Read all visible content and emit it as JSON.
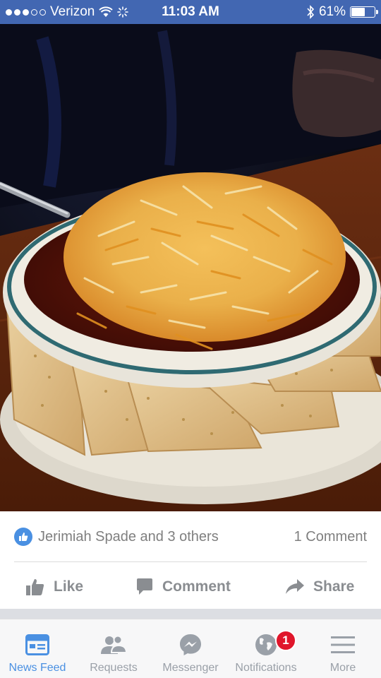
{
  "status_bar": {
    "carrier": "Verizon",
    "time": "11:03 AM",
    "battery_percent": "61%",
    "battery_level": 0.61,
    "signal_bars_filled": 3,
    "signal_bars_total": 5
  },
  "post": {
    "likes_text": "Jerimiah Spade and 3 others",
    "comments_text": "1 Comment",
    "actions": {
      "like": "Like",
      "comment": "Comment",
      "share": "Share"
    }
  },
  "tab_bar": {
    "tabs": [
      {
        "label": "News Feed",
        "icon": "news-feed-icon",
        "active": true
      },
      {
        "label": "Requests",
        "icon": "friend-requests-icon",
        "active": false
      },
      {
        "label": "Messenger",
        "icon": "messenger-icon",
        "active": false
      },
      {
        "label": "Notifications",
        "icon": "globe-icon",
        "active": false,
        "badge": "1"
      },
      {
        "label": "More",
        "icon": "hamburger-menu-icon",
        "active": false
      }
    ]
  },
  "colors": {
    "facebook_blue": "#4267b2",
    "accent_blue": "#4a90e2",
    "badge_red": "#e0162b",
    "inactive_gray": "#9aa0a8"
  }
}
